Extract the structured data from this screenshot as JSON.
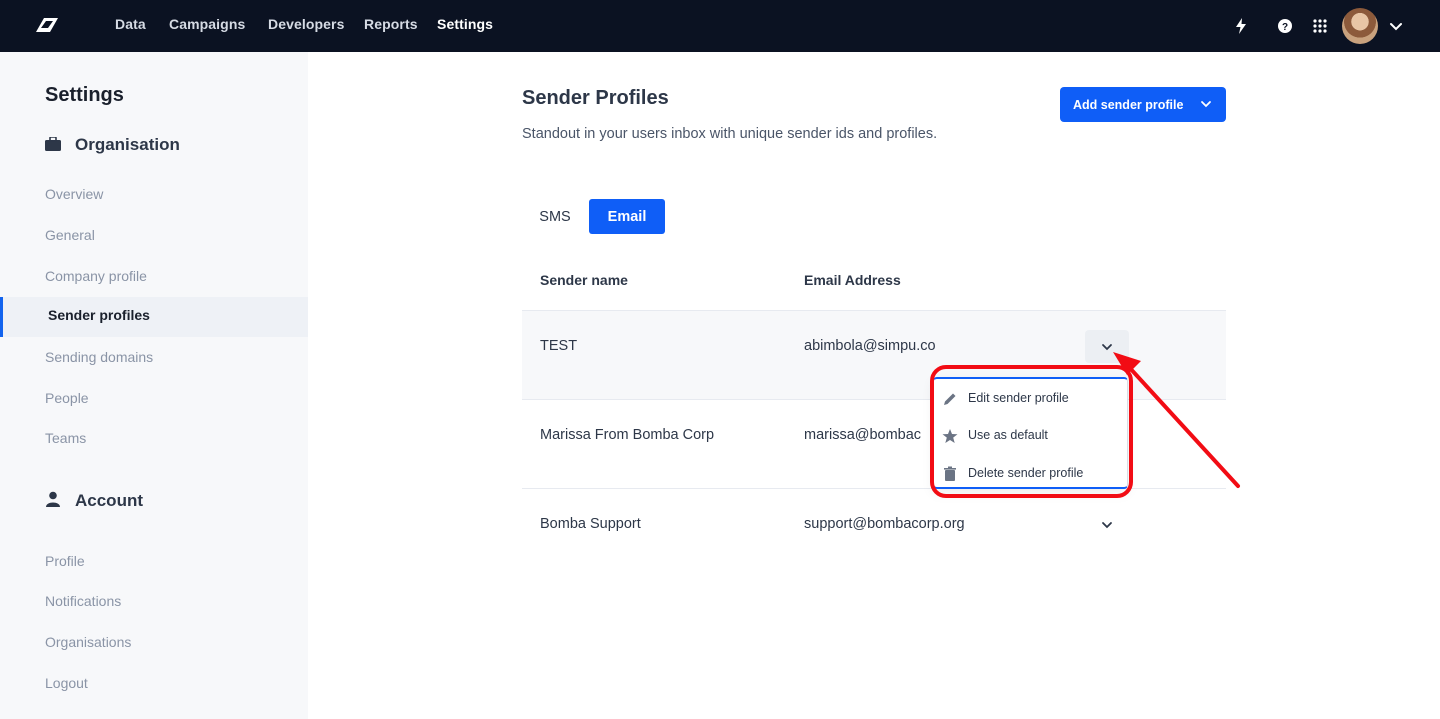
{
  "nav": {
    "links": [
      "Data",
      "Campaigns",
      "Developers",
      "Reports",
      "Settings"
    ],
    "active": "Settings"
  },
  "sidebar": {
    "title": "Settings",
    "organisation_label": "Organisation",
    "organisation_items": [
      "Overview",
      "General",
      "Company profile",
      "Sender profiles",
      "Sending domains",
      "People",
      "Teams"
    ],
    "active_item": "Sender profiles",
    "account_label": "Account",
    "account_items": [
      "Profile",
      "Notifications",
      "Organisations",
      "Logout"
    ]
  },
  "main": {
    "title": "Sender Profiles",
    "subtitle": "Standout in your users inbox with unique sender ids and profiles.",
    "add_button_label": "Add sender profile",
    "tabs": [
      "SMS",
      "Email"
    ],
    "active_tab": "Email",
    "columns": [
      "Sender name",
      "Email Address"
    ],
    "rows": [
      {
        "name": "TEST",
        "email": "abimbola@simpu.co"
      },
      {
        "name": "Marissa From Bomba Corp",
        "email": "marissa@bombac"
      },
      {
        "name": "Bomba Support",
        "email": "support@bombacorp.org"
      }
    ]
  },
  "menu": {
    "items": [
      "Edit sender profile",
      "Use as default",
      "Delete sender profile"
    ],
    "icons": [
      "pencil-icon",
      "star-icon",
      "trash-icon"
    ]
  },
  "colors": {
    "nav_bg": "#0b1222",
    "primary": "#0f5ef7",
    "annotation": "#f20c14"
  }
}
